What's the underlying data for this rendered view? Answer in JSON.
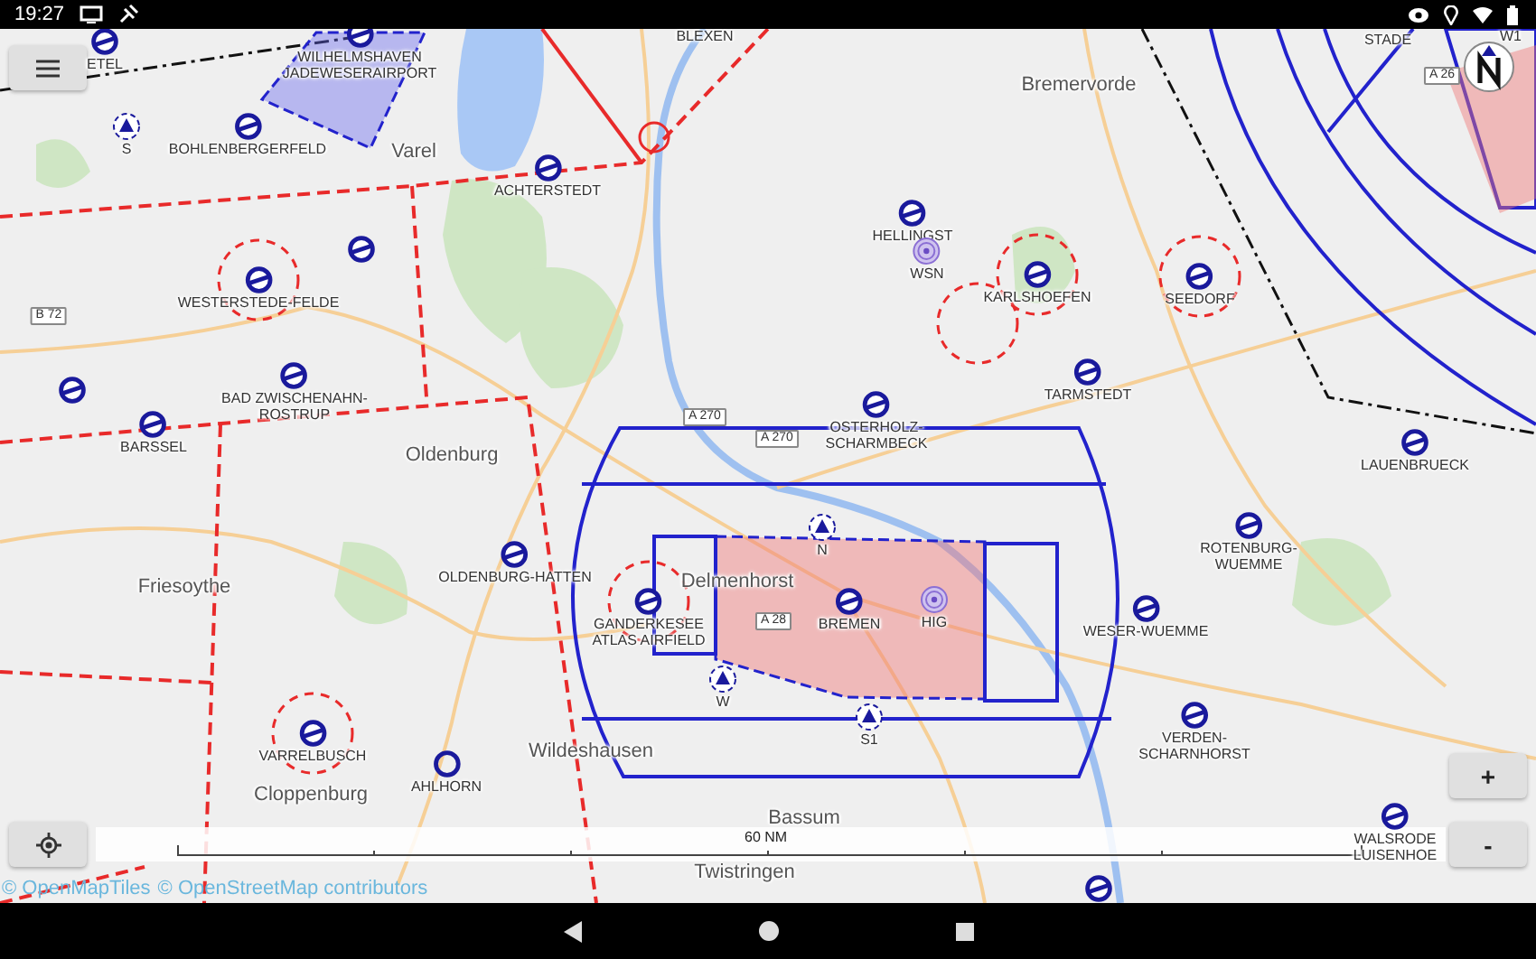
{
  "status_bar": {
    "time": "19:27"
  },
  "map": {
    "places": [
      {
        "kind": "airfield",
        "name": "ETEL",
        "circled": false
      },
      {
        "kind": "airfield",
        "name": "WILHELMSHAVEN\nJADEWESERAIRPORT",
        "circled": false
      },
      {
        "kind": "reporting",
        "name": "S"
      },
      {
        "kind": "airfield",
        "name": "BOHLENBERGERFELD",
        "circled": false
      },
      {
        "kind": "town",
        "name": "Varel"
      },
      {
        "kind": "airfield",
        "name": "ACHTERSTEDT",
        "circled": false
      },
      {
        "kind": "locality",
        "name": "BLEXEN"
      },
      {
        "kind": "airfield",
        "circled": false
      },
      {
        "kind": "airfield",
        "name": "WESTERSTEDE-FELDE",
        "circled": true
      },
      {
        "kind": "road",
        "name": "B 72"
      },
      {
        "kind": "airfield",
        "name": "BAD ZWISCHENAHN-\nROSTRUP",
        "circled": false
      },
      {
        "kind": "airfield",
        "circled": false
      },
      {
        "kind": "airfield",
        "name": "BARSSEL",
        "circled": false
      },
      {
        "kind": "town",
        "name": "Oldenburg"
      },
      {
        "kind": "road",
        "name": "A 270"
      },
      {
        "kind": "town",
        "name": "Bremervorde"
      },
      {
        "kind": "airfield",
        "name": "HELLINGST",
        "circled": false
      },
      {
        "kind": "navaid",
        "name": "WSN"
      },
      {
        "kind": "airfield",
        "name": "KARLSHOEFEN",
        "circled": true
      },
      {
        "kind": "airfield",
        "name": "SEEDORF",
        "circled": true
      },
      {
        "kind": "airfield",
        "name": "TARMSTEDT",
        "circled": false
      },
      {
        "kind": "road",
        "name": "A 270"
      },
      {
        "kind": "airfield",
        "name": "OSTERHOLZ-\nSCHARMBECK",
        "circled": false
      },
      {
        "kind": "locality",
        "name": "STADE"
      },
      {
        "kind": "road",
        "name": "A 26"
      },
      {
        "kind": "airfield",
        "name": "LAUENBRUECK",
        "circled": false
      },
      {
        "kind": "airfield",
        "name": "ROTENBURG-\nWUEMME",
        "circled": false
      },
      {
        "kind": "airfield",
        "name": "OLDENBURG-HATTEN",
        "circled": false
      },
      {
        "kind": "town",
        "name": "Friesoythe"
      },
      {
        "kind": "town",
        "name": "Delmenhorst"
      },
      {
        "kind": "airfield",
        "name": "GANDERKESEE\nATLAS AIRFIELD",
        "circled": true
      },
      {
        "kind": "reporting",
        "name": "N"
      },
      {
        "kind": "road",
        "name": "A 28"
      },
      {
        "kind": "airfield",
        "name": "BREMEN",
        "circled": false
      },
      {
        "kind": "navaid",
        "name": "HIG"
      },
      {
        "kind": "airfield",
        "name": "WESER-WUEMME",
        "circled": false
      },
      {
        "kind": "reporting",
        "name": "W"
      },
      {
        "kind": "reporting",
        "name": "S1"
      },
      {
        "kind": "airfield",
        "name": "VARRELBUSCH",
        "circled": true
      },
      {
        "kind": "military",
        "name": "AHLHORN",
        "circled": false
      },
      {
        "kind": "town",
        "name": "Wildeshausen"
      },
      {
        "kind": "airfield",
        "name": "VERDEN-\nSCHARNHORST",
        "circled": false
      },
      {
        "kind": "town",
        "name": "Cloppenburg"
      },
      {
        "kind": "town",
        "name": "Bassum"
      },
      {
        "kind": "town",
        "name": "Twistringen"
      },
      {
        "kind": "airfield",
        "name": "WALSRODE\nLUISENHOE",
        "circled": false
      },
      {
        "kind": "airfield",
        "circled": false
      },
      {
        "kind": "locality",
        "name": "W1"
      }
    ],
    "scale": {
      "label": "60 NM"
    },
    "attribution": [
      "© OpenMapTiles",
      "© OpenStreetMap contributors"
    ],
    "zoom_buttons": [
      "+",
      "-"
    ]
  }
}
